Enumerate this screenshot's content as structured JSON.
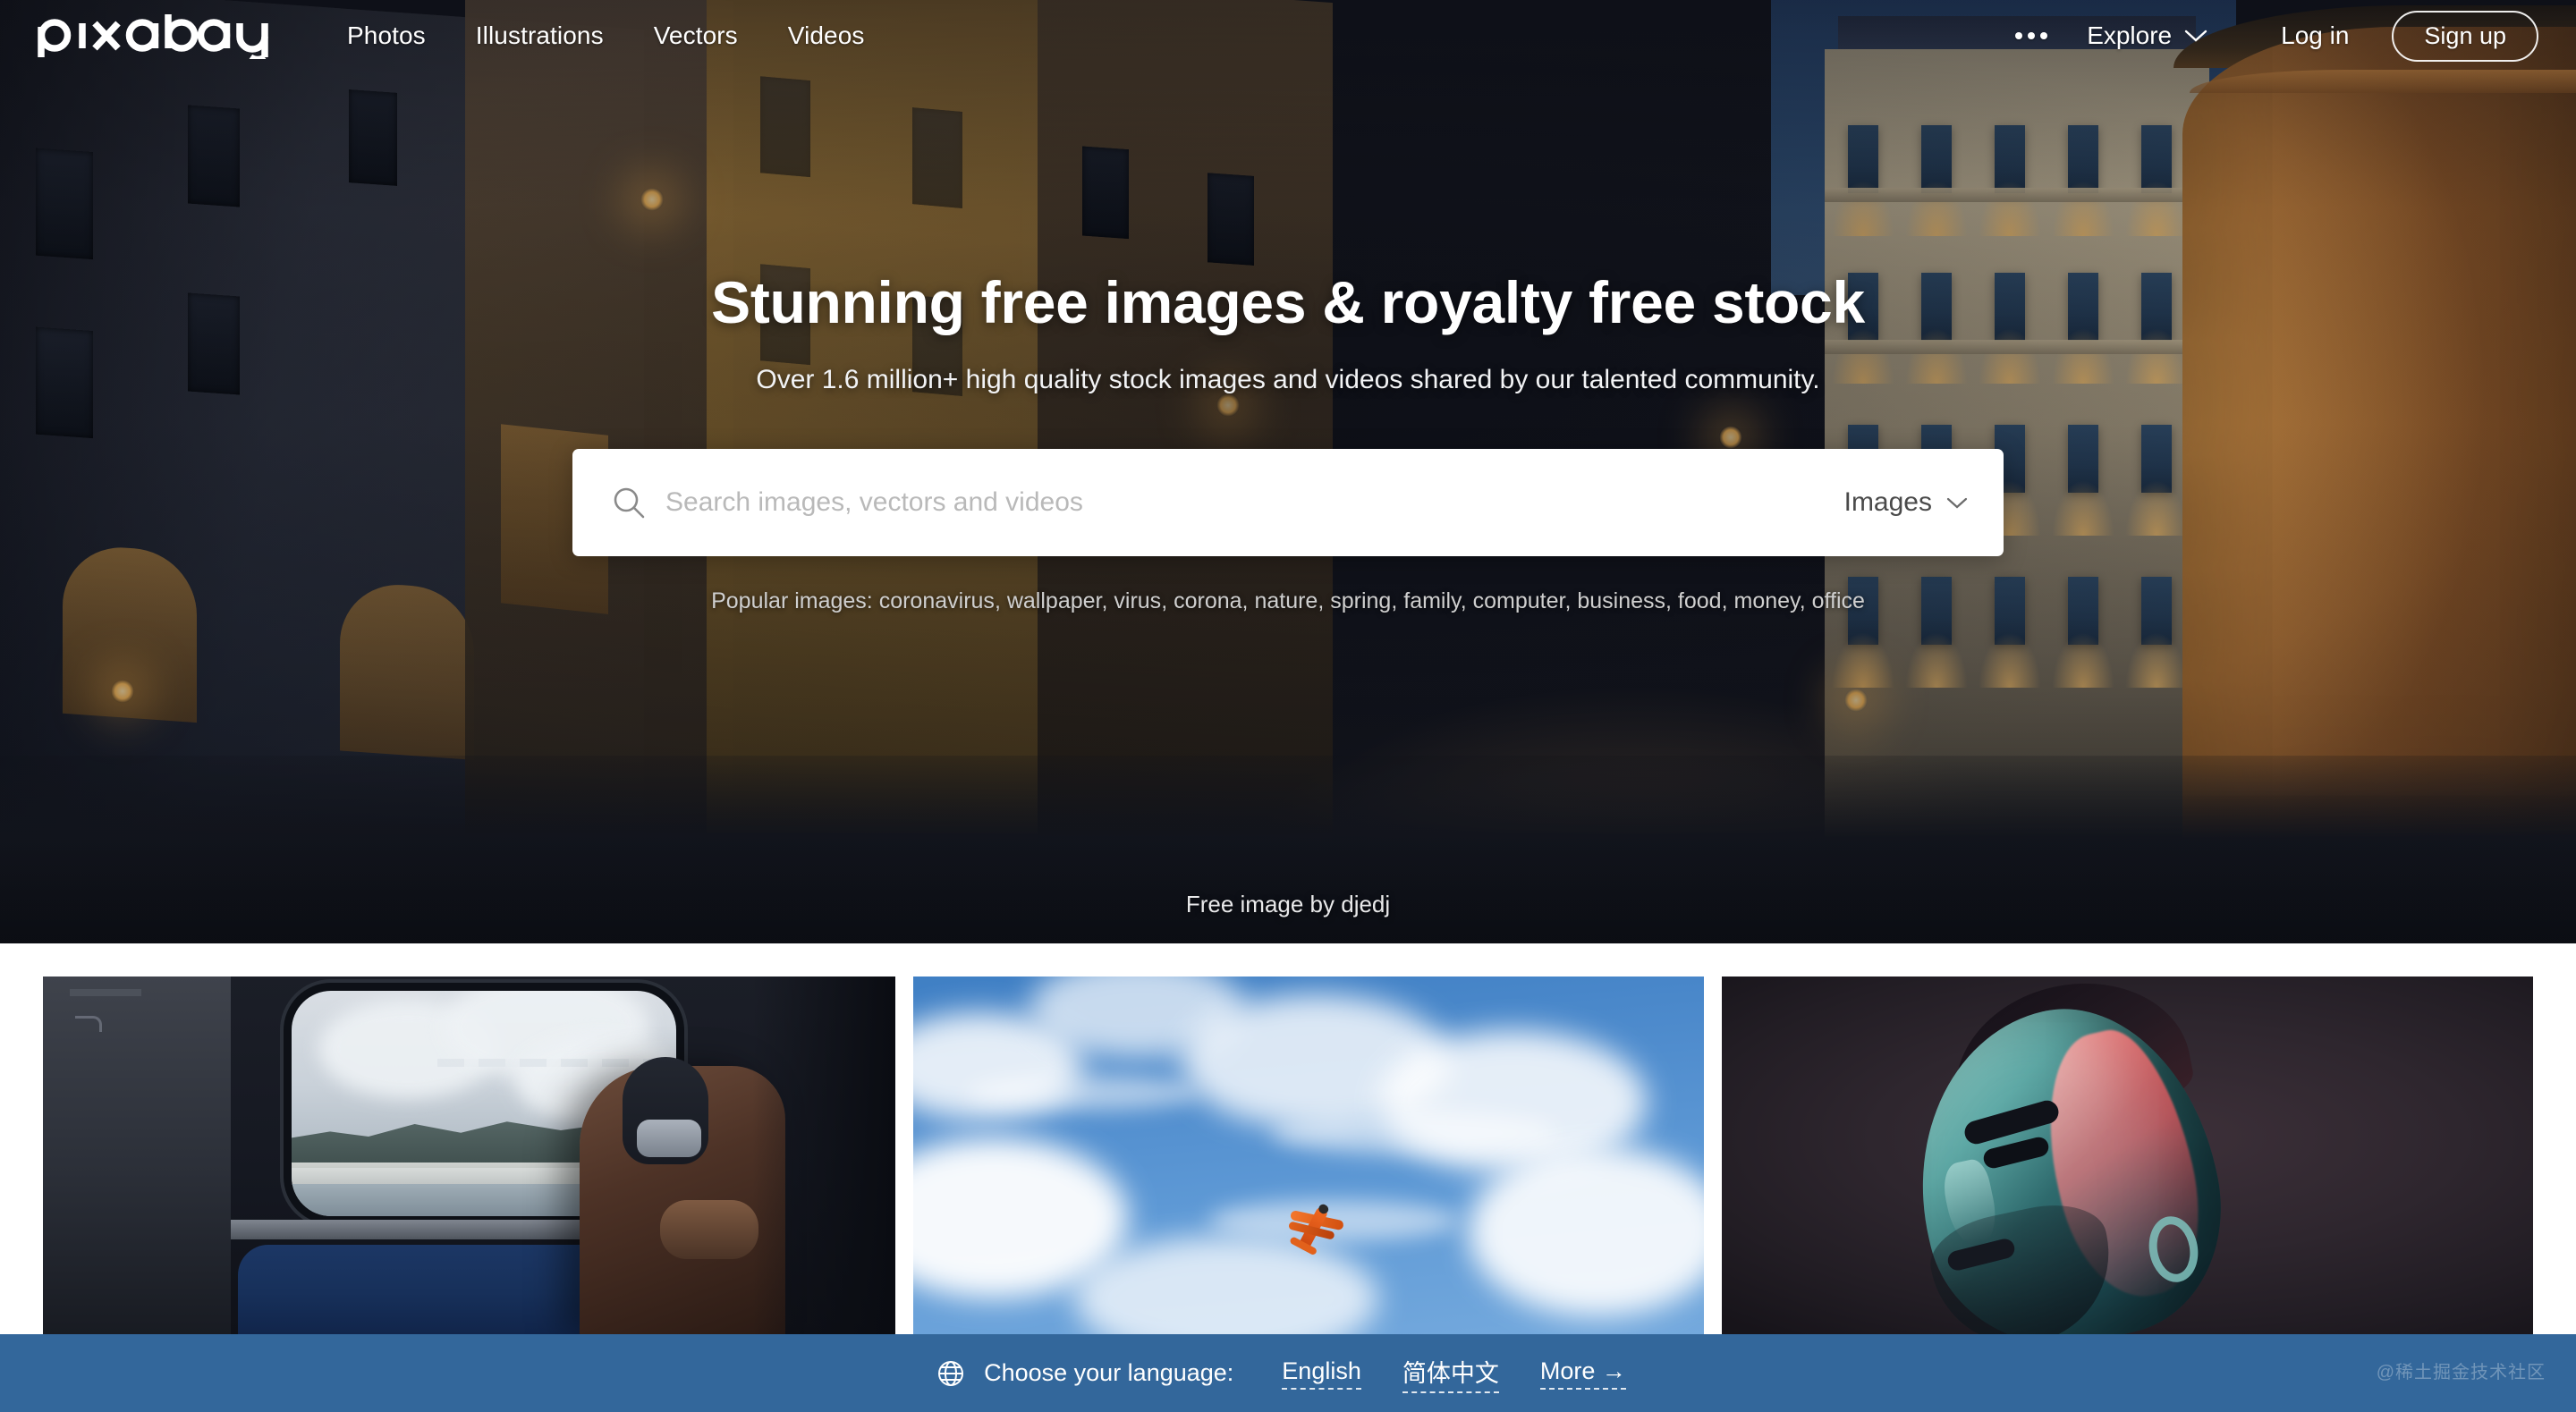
{
  "header": {
    "logo_text": "pixabay",
    "nav": [
      {
        "label": "Photos"
      },
      {
        "label": "Illustrations"
      },
      {
        "label": "Vectors"
      },
      {
        "label": "Videos"
      }
    ],
    "more_menu_icon": "ellipsis-icon",
    "explore_label": "Explore",
    "explore_chevron_icon": "chevron-down-icon",
    "login_label": "Log in",
    "signup_label": "Sign up"
  },
  "hero": {
    "title": "Stunning free images & royalty free stock",
    "subtitle": "Over 1.6 million+ high quality stock images and videos shared by our talented community.",
    "credit": "Free image by djedj",
    "search": {
      "icon": "search-icon",
      "placeholder": "Search images, vectors and videos",
      "value": "",
      "type_selected": "Images",
      "type_chevron_icon": "chevron-down-icon"
    },
    "popular": {
      "label": "Popular images:",
      "tags": [
        "coronavirus",
        "wallpaper",
        "virus",
        "corona",
        "nature",
        "spring",
        "family",
        "computer",
        "business",
        "food",
        "money",
        "office"
      ]
    }
  },
  "gallery": {
    "items": [
      {
        "name": "person-at-train-window"
      },
      {
        "name": "orange-biplane-in-blue-sky"
      },
      {
        "name": "duotone-portrait-man"
      }
    ]
  },
  "language_bar": {
    "globe_icon": "globe-icon",
    "label": "Choose your language:",
    "options": [
      {
        "label": "English"
      },
      {
        "label": "简体中文"
      },
      {
        "label": "More →"
      }
    ],
    "background_color": "#33679b"
  },
  "watermark": {
    "text": "@稀土掘金技术社区"
  }
}
